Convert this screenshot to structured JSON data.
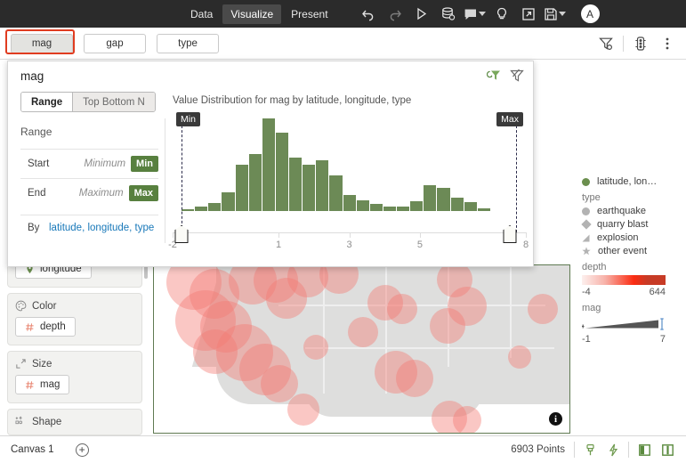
{
  "topbar": {
    "nav": [
      {
        "label": "Data",
        "active": false
      },
      {
        "label": "Visualize",
        "active": true
      },
      {
        "label": "Present",
        "active": false
      }
    ],
    "icons": [
      "undo-icon",
      "redo-icon",
      "run-icon",
      "database-icon",
      "comment-icon",
      "bulb-icon",
      "export-icon",
      "save-icon"
    ],
    "avatar_initial": "A"
  },
  "tabrow": {
    "tabs": [
      {
        "label": "mag",
        "selected": true
      },
      {
        "label": "gap",
        "selected": false
      },
      {
        "label": "type",
        "selected": false
      }
    ],
    "right_icons": [
      "filter-settings-icon",
      "traffic-light-icon",
      "more-options-icon"
    ]
  },
  "popup": {
    "title": "mag",
    "header_icons": [
      "apply-filter-icon",
      "clear-filter-icon"
    ],
    "segmented": [
      {
        "label": "Range",
        "active": true
      },
      {
        "label": "Top Bottom N",
        "active": false
      }
    ],
    "range_section_label": "Range",
    "rows": [
      {
        "label": "Start",
        "placeholder": "Minimum",
        "button": "Min"
      },
      {
        "label": "End",
        "placeholder": "Maximum",
        "button": "Max"
      }
    ],
    "by": {
      "label": "By",
      "value": "latitude, longitude, type"
    },
    "min_badge": "Min",
    "max_badge": "Max"
  },
  "chart_data": {
    "type": "bar",
    "title": "Value Distribution for mag by latitude, longitude, type",
    "xlabel": "",
    "ylabel": "",
    "xlim": [
      -2,
      8
    ],
    "xticks": [
      -2,
      1,
      3,
      5,
      8
    ],
    "xtick_labels": [
      "-2",
      "1",
      "3",
      "5",
      "8"
    ],
    "grid": false,
    "legend": "none",
    "bin_starts": [
      -0.1,
      0.2,
      0.5,
      0.8,
      1.1,
      1.4,
      1.7,
      2.0,
      2.3,
      2.6,
      2.9,
      3.2,
      3.5,
      3.8,
      4.1,
      4.4,
      4.7,
      5.0,
      5.3,
      5.6,
      5.9,
      6.2,
      6.5,
      6.8,
      7.1
    ],
    "categories": [
      "-0.1",
      "0.2",
      "0.5",
      "0.8",
      "1.1",
      "1.4",
      "1.7",
      "2.0",
      "2.3",
      "2.6",
      "2.9",
      "3.2",
      "3.5",
      "3.8",
      "4.1",
      "4.4",
      "4.7",
      "5.0",
      "5.3",
      "5.6",
      "5.9",
      "6.2",
      "6.5",
      "6.8",
      "7.1"
    ],
    "values": [
      2,
      5,
      9,
      20,
      50,
      62,
      100,
      85,
      58,
      50,
      55,
      38,
      17,
      12,
      8,
      5,
      5,
      11,
      28,
      25,
      14,
      10,
      3,
      0,
      0
    ],
    "selection": {
      "min": -2,
      "max": 8
    }
  },
  "sidebar": {
    "cards": [
      {
        "name": "location-card",
        "title": "",
        "icon": "location-pin-icon",
        "pill": "longitude",
        "pill_icon": "location-pin-icon",
        "partial": true
      },
      {
        "name": "color-card",
        "title": "Color",
        "icon": "palette-icon",
        "pill": "depth",
        "pill_icon": "hash-icon"
      },
      {
        "name": "size-card",
        "title": "Size",
        "icon": "resize-icon",
        "pill": "mag",
        "pill_icon": "hash-icon"
      },
      {
        "name": "shape-card",
        "title": "Shape",
        "icon": "shape-icon",
        "pill": "",
        "pill_icon": ""
      }
    ]
  },
  "legend": {
    "series": {
      "label": "latitude, lon…",
      "marker": "circle",
      "color": "#6b8f4e"
    },
    "type_header": "type",
    "type_items": [
      {
        "label": "earthquake",
        "shape": "circle"
      },
      {
        "label": "quarry blast",
        "shape": "diamond"
      },
      {
        "label": "explosion",
        "shape": "triangle"
      },
      {
        "label": "other event",
        "shape": "star"
      }
    ],
    "depth": {
      "header": "depth",
      "min": "-4",
      "max": "644"
    },
    "mag": {
      "header": "mag",
      "min": "-1",
      "max": "7"
    }
  },
  "statusbar": {
    "canvas_label": "Canvas 1",
    "add_icon": "add-canvas-icon",
    "points": "6903 Points",
    "icons": [
      "brush-icon",
      "lightning-icon",
      "panel-left-icon",
      "panel-right-icon"
    ]
  },
  "colors": {
    "accent_green": "#58803f",
    "link_blue": "#1878b9",
    "highlight_red": "#e03c20",
    "bar_green": "#6c8a56",
    "topbar_bg": "#2b2b2b"
  }
}
